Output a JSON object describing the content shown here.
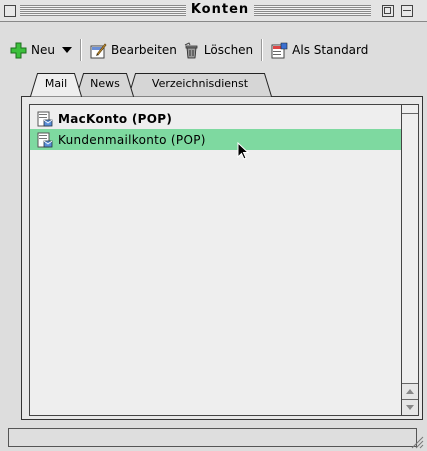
{
  "window": {
    "title": "Konten"
  },
  "toolbar": {
    "new_label": "Neu",
    "edit_label": "Bearbeiten",
    "delete_label": "Löschen",
    "default_label": "Als Standard"
  },
  "tabs": [
    {
      "label": "Mail",
      "active": true
    },
    {
      "label": "News",
      "active": false
    },
    {
      "label": "Verzeichnisdienst",
      "active": false
    }
  ],
  "accounts": [
    {
      "label": "MacKonto   (POP)",
      "bold": true,
      "selected": false
    },
    {
      "label": "Kundenmailkonto (POP)",
      "bold": false,
      "selected": true
    }
  ],
  "colors": {
    "selection": "#7ed9a0",
    "window_bg": "#dddddd"
  },
  "icons": {
    "new": "plus-icon",
    "edit": "edit-icon",
    "delete": "trash-icon",
    "default": "default-account-icon",
    "account": "mail-account-icon"
  }
}
